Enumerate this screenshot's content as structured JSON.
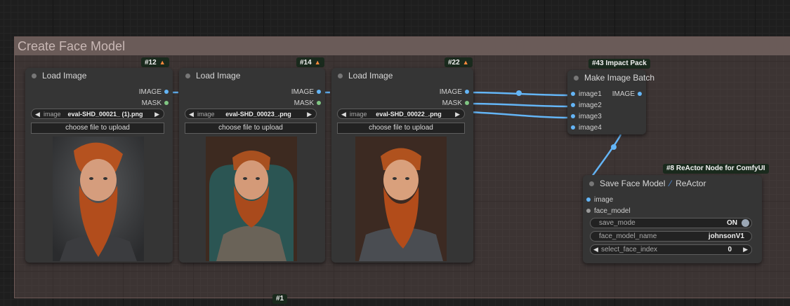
{
  "group": {
    "title": "Create Face Model",
    "badge": "#1"
  },
  "nodes": {
    "load1": {
      "badge": "#12",
      "title": "Load Image",
      "outputs": [
        "IMAGE",
        "MASK"
      ],
      "image_label": "image",
      "image_value": "eval-SHD_00021_ (1).png",
      "upload_label": "choose file to upload"
    },
    "load2": {
      "badge": "#14",
      "title": "Load Image",
      "outputs": [
        "IMAGE",
        "MASK"
      ],
      "image_label": "image",
      "image_value": "eval-SHD_00023_.png",
      "upload_label": "choose file to upload"
    },
    "load3": {
      "badge": "#22",
      "title": "Load Image",
      "outputs": [
        "IMAGE",
        "MASK"
      ],
      "image_label": "image",
      "image_value": "eval-SHD_00022_.png",
      "upload_label": "choose file to upload"
    },
    "batch": {
      "badge": "#43 Impact Pack",
      "title": "Make Image Batch",
      "inputs": [
        "image1",
        "image2",
        "image3",
        "image4"
      ],
      "output": "IMAGE"
    },
    "save": {
      "badge": "#8 ReActor Node for ComfyUI",
      "title": "Save Face Model",
      "title_suffix": "ReActor",
      "inputs": [
        "image",
        "face_model"
      ],
      "save_mode_label": "save_mode",
      "save_mode_value": "ON",
      "name_label": "face_model_name",
      "name_value": "johnsonV1",
      "index_label": "select_face_index",
      "index_value": "0"
    }
  },
  "colors": {
    "link_image": "#64b5f6",
    "link_mask": "#81c784",
    "badge_bg": "#1a2a1d",
    "group_header": "#6a5b58",
    "node_bg": "#353535"
  },
  "icons": [
    "fox-icon",
    "feather-icon",
    "arrow-left-icon",
    "arrow-right-icon",
    "toggle-icon"
  ]
}
